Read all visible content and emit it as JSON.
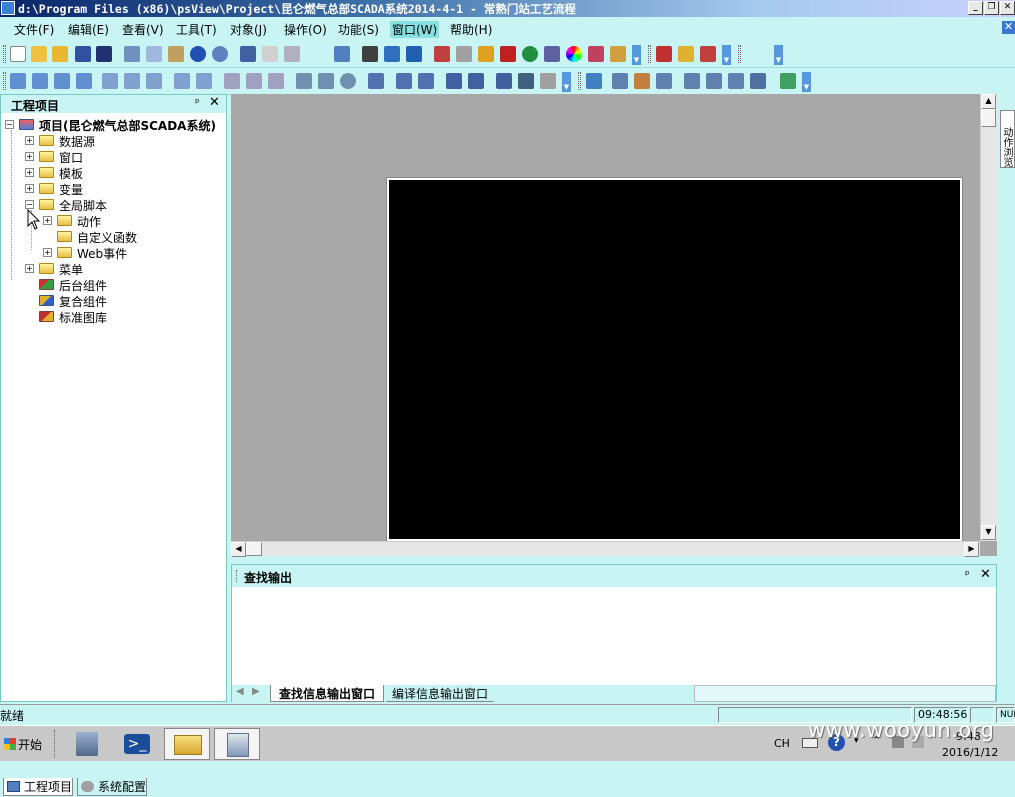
{
  "window": {
    "title": "d:\\Program Files (x86)\\psView\\Project\\昆仑燃气总部SCADA系统2014-4-1 - 常熟门站工艺流程",
    "minimize": "_",
    "restore": "❐",
    "close": "✕"
  },
  "menu": {
    "items": [
      "文件(F)",
      "编辑(E)",
      "查看(V)",
      "工具(T)",
      "对象(J)",
      "操作(O)",
      "功能(S)",
      "窗口(W)",
      "帮助(H)"
    ],
    "mdi_close": "✕"
  },
  "project_panel": {
    "title": "工程项目",
    "pin": "ᵖ",
    "close": "✕",
    "tree": {
      "root": "项目(昆仑燃气总部SCADA系统)",
      "nodes": [
        "数据源",
        "窗口",
        "模板",
        "变量",
        "全局脚本"
      ],
      "script_children": [
        "动作",
        "自定义函数",
        "Web事件"
      ],
      "more_nodes": [
        "菜单",
        "后台组件",
        "复合组件",
        "标准图库"
      ]
    },
    "tabs": [
      "工程项目",
      "系统配置"
    ]
  },
  "side_tab": "动作浏览",
  "output_panel": {
    "title": "查找输出",
    "pin": "ᵖ",
    "close": "✕",
    "tabs": [
      "查找信息输出窗口",
      "编译信息输出窗口"
    ]
  },
  "status": {
    "text": "就绪",
    "time": "09:48:56",
    "num": "NUM"
  },
  "taskbar": {
    "start": "开始",
    "lang": "CH",
    "clock_time": "9:48",
    "clock_date": "2016/1/12"
  },
  "watermark": "www.wooyun.org",
  "colors": {
    "chrome": "#c8f4f4",
    "workspace": "#a8a8a8",
    "canvas": "#000000"
  }
}
